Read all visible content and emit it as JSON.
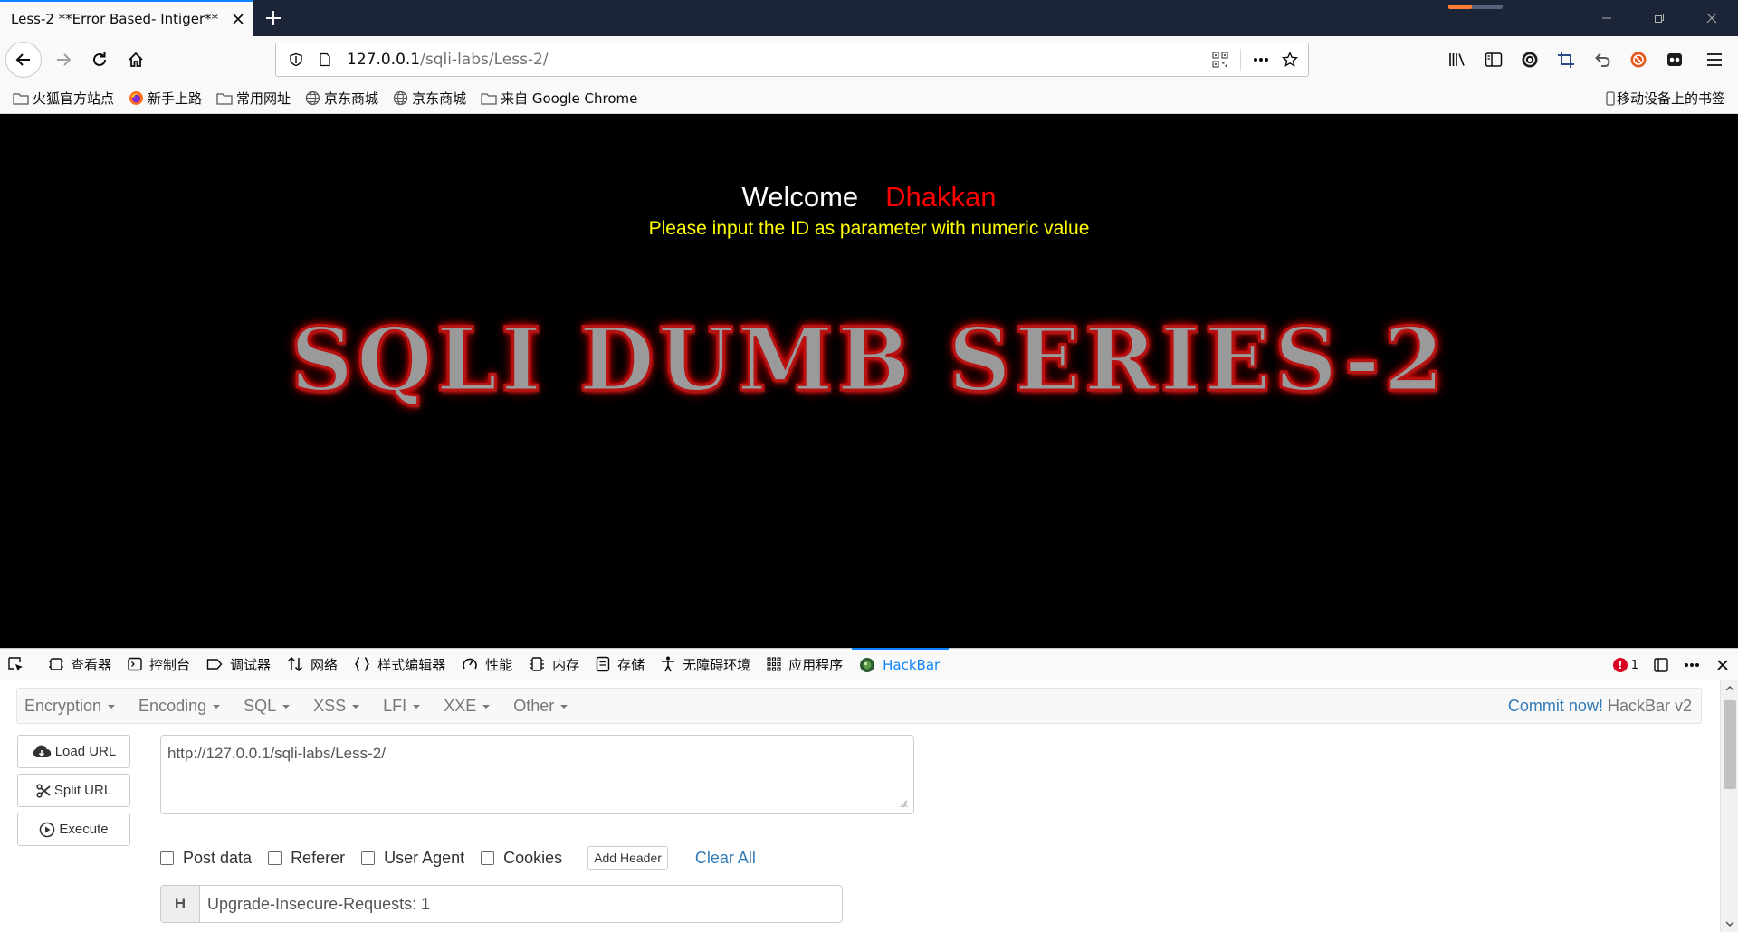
{
  "browser": {
    "tab_title": "Less-2 **Error Based- Intiger**",
    "url_host": "127.0.0.1",
    "url_path": "/sqli-labs/Less-2/"
  },
  "bookmarks": {
    "items": [
      {
        "label": "火狐官方站点",
        "icon": "folder-icon"
      },
      {
        "label": "新手上路",
        "icon": "firefox-icon"
      },
      {
        "label": "常用网址",
        "icon": "folder-icon"
      },
      {
        "label": "京东商城",
        "icon": "globe-icon"
      },
      {
        "label": "京东商城",
        "icon": "globe-icon"
      },
      {
        "label": "来自 Google Chrome",
        "icon": "folder-icon"
      }
    ],
    "mobile": "移动设备上的书签"
  },
  "page": {
    "welcome": "Welcome",
    "user": "Dhakkan",
    "instruction": "Please input the ID as parameter with numeric value",
    "banner": "SQLI DUMB SERIES-2",
    "colors": {
      "background": "#000000",
      "welcome": "#ffffff",
      "user": "#ff0000",
      "instruction": "#ffff00",
      "banner_glow": "#ff0000"
    }
  },
  "devtools": {
    "tabs": [
      {
        "label": "查看器",
        "icon": "inspector-icon"
      },
      {
        "label": "控制台",
        "icon": "console-icon"
      },
      {
        "label": "调试器",
        "icon": "debugger-icon"
      },
      {
        "label": "网络",
        "icon": "network-icon"
      },
      {
        "label": "样式编辑器",
        "icon": "style-editor-icon"
      },
      {
        "label": "性能",
        "icon": "performance-icon"
      },
      {
        "label": "内存",
        "icon": "memory-icon"
      },
      {
        "label": "存储",
        "icon": "storage-icon"
      },
      {
        "label": "无障碍环境",
        "icon": "accessibility-icon"
      },
      {
        "label": "应用程序",
        "icon": "application-icon"
      },
      {
        "label": "HackBar",
        "icon": "hackbar-icon",
        "active": true
      }
    ],
    "error_count": "1"
  },
  "hackbar": {
    "menu": [
      "Encryption",
      "Encoding",
      "SQL",
      "XSS",
      "LFI",
      "XXE",
      "Other"
    ],
    "commit_link": "Commit now!",
    "version": "HackBar v2",
    "buttons": {
      "load": "Load URL",
      "split": "Split URL",
      "execute": "Execute"
    },
    "url_value": "http://127.0.0.1/sqli-labs/Less-2/",
    "options": {
      "post": "Post data",
      "referer": "Referer",
      "user_agent": "User Agent",
      "cookies": "Cookies"
    },
    "add_header": "Add Header",
    "clear_all": "Clear All",
    "header_label": "H",
    "header_value": "Upgrade-Insecure-Requests: 1",
    "accent": "#337ab7"
  }
}
